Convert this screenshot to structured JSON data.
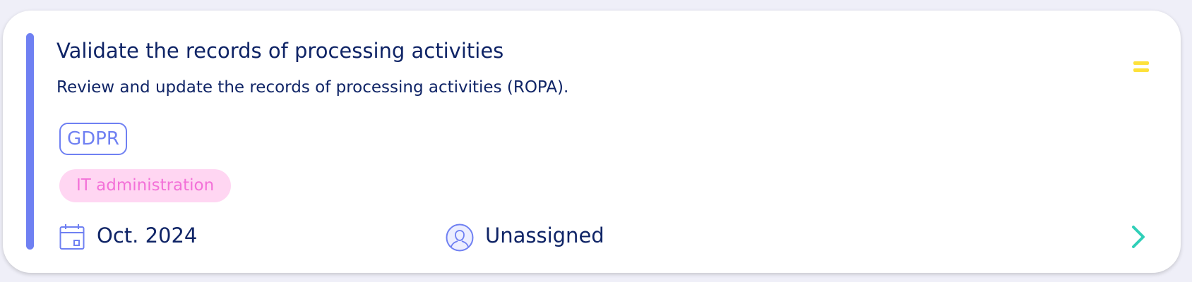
{
  "task": {
    "title": "Validate the records of processing activities",
    "description": "Review and update the records of processing activities (ROPA).",
    "tag": "GDPR",
    "category": "IT administration",
    "due_date": "Oct. 2024",
    "assignee": "Unassigned"
  },
  "icons": {
    "priority": "priority-medium-icon",
    "calendar": "calendar-icon",
    "user": "user-avatar-icon",
    "open": "chevron-right-icon"
  },
  "colors": {
    "accent": "#6f80f2",
    "text": "#0f2466",
    "priority": "#fde13a",
    "category_bg": "#ffd6f2",
    "category_text": "#f371d8",
    "chevron": "#2fcfb8"
  }
}
